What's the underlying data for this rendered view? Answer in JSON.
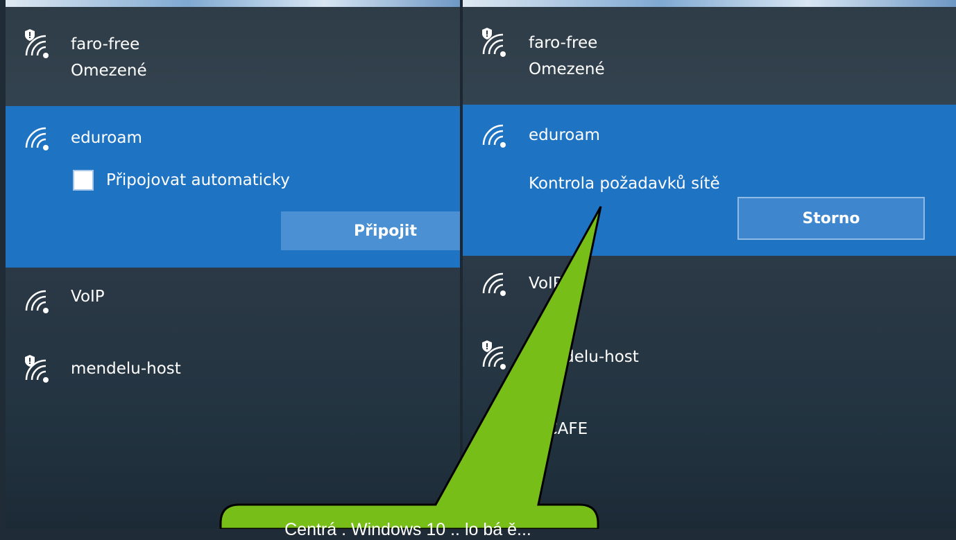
{
  "left_panel": {
    "networks": [
      {
        "ssid": "faro-free",
        "status": "Omezené",
        "secured_warning": true
      },
      {
        "ssid": "eduroam",
        "selected": true,
        "auto_connect_label": "Připojovat automaticky",
        "connect_label": "Připojit"
      },
      {
        "ssid": "VoIP"
      },
      {
        "ssid": "mendelu-host",
        "secured_warning": true
      }
    ]
  },
  "right_panel": {
    "networks": [
      {
        "ssid": "faro-free",
        "status": "Omezené",
        "secured_warning": true
      },
      {
        "ssid": "eduroam",
        "selected": true,
        "status": "Kontrola požadavků sítě",
        "cancel_label": "Storno"
      },
      {
        "ssid": "VoIP"
      },
      {
        "ssid": "mendelu-host",
        "secured_warning": true
      },
      {
        "ssid": "T_CAFE"
      }
    ]
  },
  "callout": {
    "text": "Centrá . Windows 10 .. lo bá ě..."
  },
  "colors": {
    "selected": "#1e73c3",
    "callout_fill": "#78be18",
    "button": "#4a90d2"
  }
}
